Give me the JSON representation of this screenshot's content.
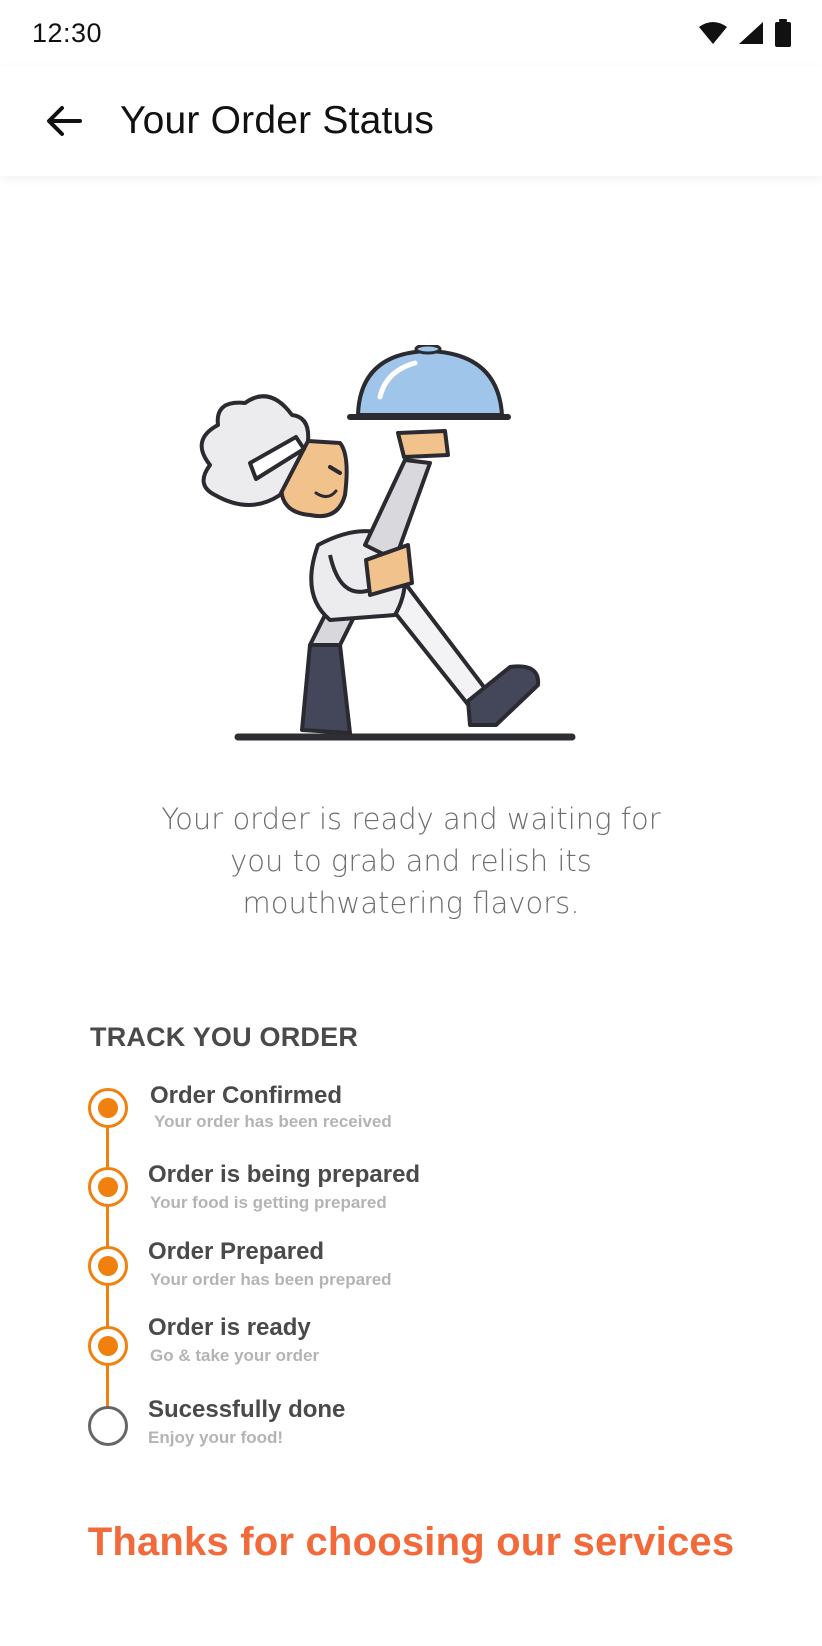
{
  "status_bar": {
    "time": "12:30",
    "icons": [
      "wifi-icon",
      "signal-icon",
      "battery-icon"
    ]
  },
  "app_bar": {
    "back_icon": "arrow-left-icon",
    "title": "Your Order Status"
  },
  "illustration": {
    "icon": "chef-carrying-cloche-illustration"
  },
  "description": "Your order is ready and waiting for you to grab and relish its mouthwatering flavors.",
  "tracking": {
    "heading": "TRACK YOU ORDER",
    "steps": [
      {
        "title": "Order Confirmed",
        "subtitle": "Your order has been received",
        "completed": true
      },
      {
        "title": "Order is being prepared",
        "subtitle": "Your food is getting prepared",
        "completed": true
      },
      {
        "title": "Order Prepared",
        "subtitle": "Your order has been prepared",
        "completed": true
      },
      {
        "title": "Order is ready",
        "subtitle": "Go & take your order",
        "completed": true
      },
      {
        "title": "Sucessfully done",
        "subtitle": "Enjoy your food!",
        "completed": false
      }
    ]
  },
  "footer": {
    "thanks": "Thanks for choosing our services"
  },
  "colors": {
    "accent": "#f0810f",
    "thanks_text": "#f26a3a",
    "cloche": "#9fc6ea"
  }
}
